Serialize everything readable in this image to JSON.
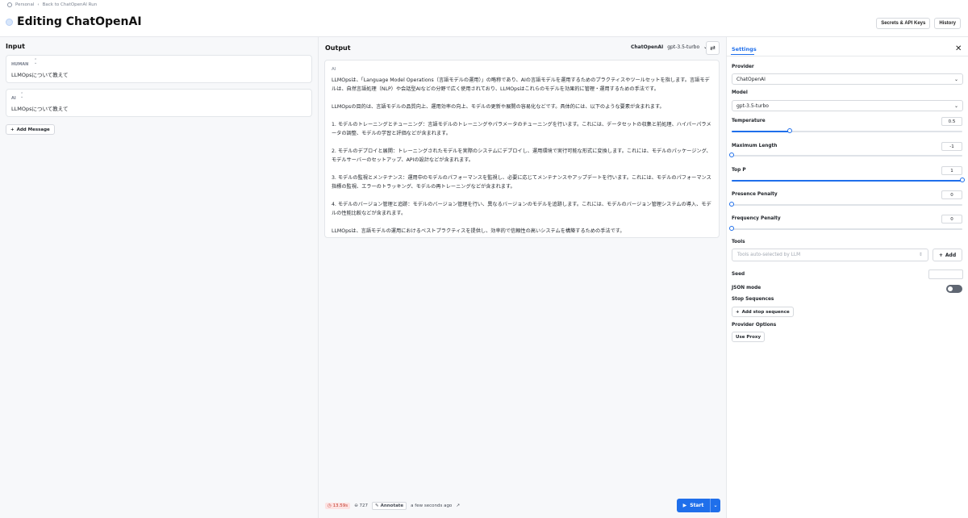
{
  "breadcrumb": {
    "workspace": "Personal",
    "back": "Back to ChatOpenAI Run"
  },
  "header": {
    "title": "Editing ChatOpenAI",
    "secrets_label": "Secrets & API Keys",
    "history_label": "History"
  },
  "input": {
    "title": "Input",
    "messages": [
      {
        "role": "HUMAN",
        "text": "LLMOpsについて教えて"
      },
      {
        "role": "AI",
        "text": "LLMOpsについて教えて"
      }
    ],
    "add_message_label": "Add Message"
  },
  "output": {
    "title": "Output",
    "provider": "ChatOpenAI",
    "model": "gpt-3.5-turbo",
    "role": "AI",
    "paragraphs": [
      "LLMOpsは、「Language Model Operations（言語モデルの運用）」の略称であり、AIの言語モデルを運用するためのプラクティスやツールセットを指します。言語モデルは、自然言語処理（NLP）や会話型AIなどの分野で広く使用されており、LLMOpsはこれらのモデルを効果的に管理・運用するための手法です。",
      "LLMOpsの目的は、言語モデルの品質向上、運用効率の向上、モデルの更新や展開の容易化などです。具体的には、以下のような要素が含まれます。",
      "1. モデルのトレーニングとチューニング：言語モデルのトレーニングやパラメータのチューニングを行います。これには、データセットの収集と前処理、ハイパーパラメータの調整、モデルの学習と評価などが含まれます。",
      "2. モデルのデプロイと展開：トレーニングされたモデルを実際のシステムにデプロイし、運用環境で実行可能な形式に変換します。これには、モデルのパッケージング、モデルサーバーのセットアップ、APIの設計などが含まれます。",
      "3. モデルの監視とメンテナンス：運用中のモデルのパフォーマンスを監視し、必要に応じてメンテナンスやアップデートを行います。これには、モデルのパフォーマンス指標の監視、エラーのトラッキング、モデルの再トレーニングなどが含まれます。",
      "4. モデルのバージョン管理と追跡：モデルのバージョン管理を行い、異なるバージョンのモデルを追跡します。これには、モデルのバージョン管理システムの導入、モデルの性能比較などが含まれます。",
      "LLMOpsは、言語モデルの運用におけるベストプラクティスを提供し、効率的で信頼性の高いシステムを構築するための手法です。"
    ],
    "status": {
      "latency": "13.59s",
      "tokens": "727",
      "annotate_label": "Annotate",
      "time": "a few seconds ago"
    },
    "start_label": "Start"
  },
  "settings": {
    "tab_label": "Settings",
    "provider_label": "Provider",
    "provider_value": "ChatOpenAI",
    "model_label": "Model",
    "model_value": "gpt-3.5-turbo",
    "temperature": {
      "label": "Temperature",
      "value": "0.5",
      "fraction": 0.25
    },
    "max_length": {
      "label": "Maximum Length",
      "value": "-1",
      "fraction": 0
    },
    "top_p": {
      "label": "Top P",
      "value": "1",
      "fraction": 1
    },
    "presence_penalty": {
      "label": "Presence Penalty",
      "value": "0",
      "fraction": 0
    },
    "frequency_penalty": {
      "label": "Frequency Penalty",
      "value": "0",
      "fraction": 0
    },
    "tools_label": "Tools",
    "tools_placeholder": "Tools auto-selected by LLM",
    "tools_add_label": "Add",
    "seed_label": "Seed",
    "json_mode_label": "JSON mode",
    "stop_sequences_label": "Stop Sequences",
    "add_stop_label": "Add stop sequence",
    "provider_options_label": "Provider Options",
    "use_proxy_label": "Use Proxy"
  },
  "colors": {
    "accent": "#1f6feb",
    "latency_badge": "#fde2e2"
  }
}
